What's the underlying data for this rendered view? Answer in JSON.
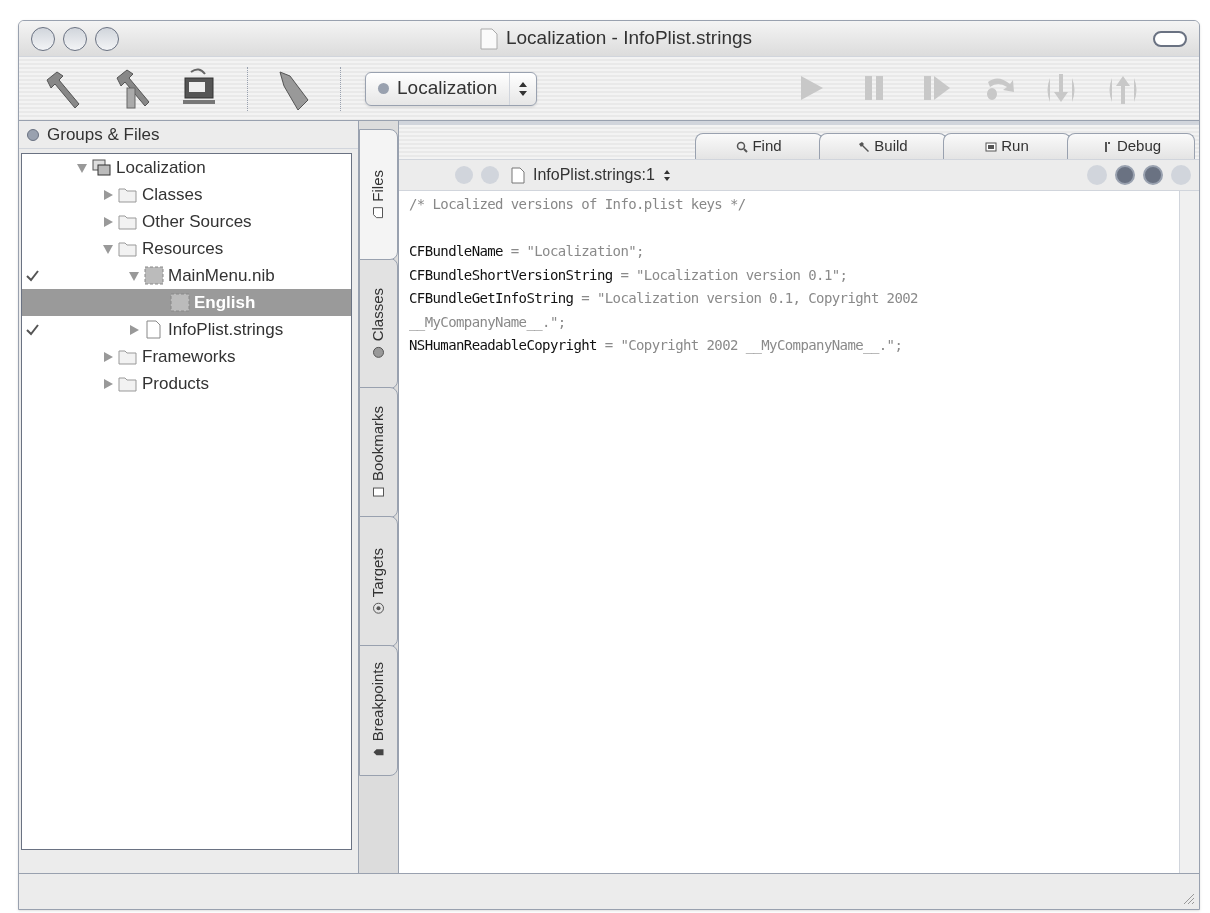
{
  "window": {
    "title": "Localization - InfoPlist.strings"
  },
  "toolbar": {
    "target_popup": "Localization",
    "debug_controls": [
      {
        "kind": "continue",
        "disabled": true
      },
      {
        "kind": "pause",
        "disabled": true
      },
      {
        "kind": "step",
        "disabled": true
      },
      {
        "kind": "over",
        "disabled": true
      },
      {
        "kind": "into",
        "disabled": true
      },
      {
        "kind": "out",
        "disabled": true
      }
    ]
  },
  "groups_files": {
    "header": "Groups & Files",
    "tree": [
      {
        "label": "Localization",
        "kind": "project",
        "expanded": true,
        "checked": false,
        "selected": false,
        "children": [
          {
            "label": "Classes",
            "kind": "folder",
            "expanded": false,
            "checked": false,
            "selected": false
          },
          {
            "label": "Other Sources",
            "kind": "folder",
            "expanded": false,
            "checked": false,
            "selected": false
          },
          {
            "label": "Resources",
            "kind": "folder",
            "expanded": true,
            "checked": false,
            "selected": false,
            "children": [
              {
                "label": "MainMenu.nib",
                "kind": "nib",
                "expanded": true,
                "checked": true,
                "selected": false,
                "children": [
                  {
                    "label": "English",
                    "kind": "nib",
                    "checked": false,
                    "selected": true
                  }
                ]
              },
              {
                "label": "InfoPlist.strings",
                "kind": "file",
                "expanded": false,
                "checked": true,
                "selected": false
              }
            ]
          },
          {
            "label": "Frameworks",
            "kind": "folder",
            "expanded": false,
            "checked": false,
            "selected": false
          },
          {
            "label": "Products",
            "kind": "folder",
            "expanded": false,
            "checked": false,
            "selected": false
          }
        ]
      }
    ]
  },
  "side_tabs": [
    {
      "label": "Files",
      "kind": "files",
      "selected": true
    },
    {
      "label": "Classes",
      "kind": "classes",
      "selected": false
    },
    {
      "label": "Bookmarks",
      "kind": "bookmarks",
      "selected": false
    },
    {
      "label": "Targets",
      "kind": "targets",
      "selected": false
    },
    {
      "label": "Breakpoints",
      "kind": "breakpoints",
      "selected": false
    }
  ],
  "mode_buttons": [
    {
      "label": "Find",
      "kind": "find"
    },
    {
      "label": "Build",
      "kind": "build"
    },
    {
      "label": "Run",
      "kind": "run"
    },
    {
      "label": "Debug",
      "kind": "debug"
    }
  ],
  "editor": {
    "file_popup": "InfoPlist.strings:1",
    "lines": [
      {
        "kind": "comment",
        "text": "/* Localized versions of Info.plist keys */"
      },
      {
        "kind": "blank"
      },
      {
        "kind": "code",
        "text": "**CFBundleName** = \"Localization\";"
      },
      {
        "kind": "code",
        "text": "**CFBundleShortVersionString** = \"Localization version 0.1\";"
      },
      {
        "kind": "code",
        "text": "**CFBundleGetInfoString** = \"Localization version 0.1, Copyright 2002"
      },
      {
        "kind": "code",
        "text": "__MyCompanyName__.\";"
      },
      {
        "kind": "code",
        "text": "**NSHumanReadableCopyright** = \"Copyright 2002 __MyCompanyName__.\";"
      }
    ]
  }
}
